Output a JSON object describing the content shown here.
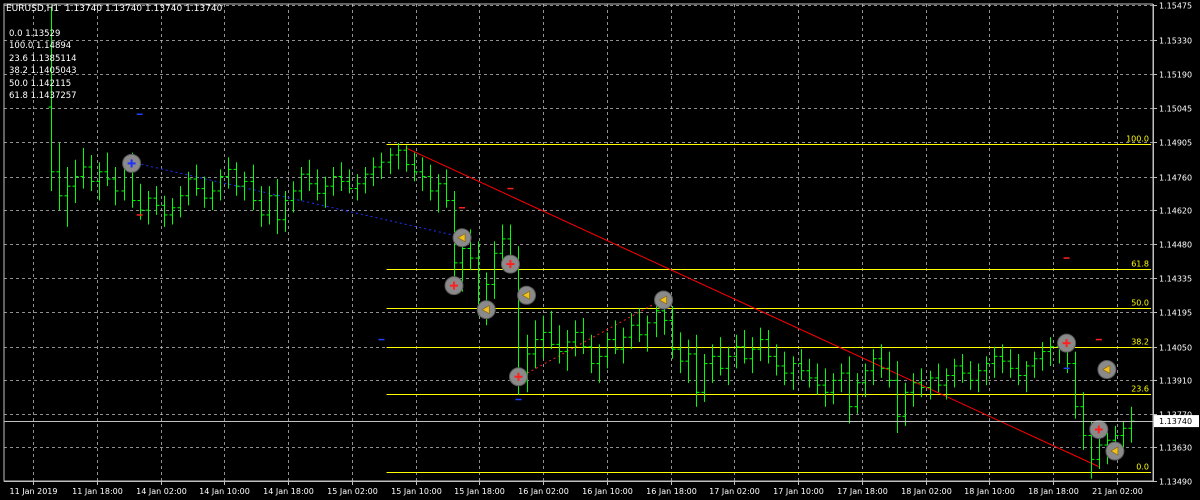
{
  "header": {
    "symbol": "EURUSD,H1",
    "ohlc": "1.13740 1.13740 1.13740 1.13740"
  },
  "fib_legend": [
    "0.0 1.13529",
    "100.0 1.14894",
    "23.6 1.1385114",
    "38.2 1.1405043",
    "50.0 1.142115",
    "61.8 1.1437257"
  ],
  "colors": {
    "background": "#000000",
    "grid": "#c0c0c0",
    "candle": "#00ff00",
    "fib_line": "#ffff00",
    "trend_line": "#ff0000",
    "current_price_bg": "#ffffff"
  },
  "chart_data": {
    "type": "candlestick",
    "symbol": "EURUSD",
    "timeframe": "H1",
    "ylim": [
      1.1349,
      1.1548
    ],
    "y_ticks": [
      "1.15475",
      "1.15330",
      "1.15190",
      "1.15045",
      "1.14905",
      "1.14760",
      "1.14620",
      "1.14480",
      "1.14335",
      "1.14195",
      "1.14050",
      "1.13910",
      "1.13770",
      "1.13630",
      "1.13490"
    ],
    "x_ticks": [
      "11 Jan 2019",
      "11 Jan 18:00",
      "14 Jan 02:00",
      "14 Jan 10:00",
      "14 Jan 18:00",
      "15 Jan 02:00",
      "15 Jan 10:00",
      "15 Jan 18:00",
      "16 Jan 02:00",
      "16 Jan 10:00",
      "16 Jan 18:00",
      "17 Jan 02:00",
      "17 Jan 10:00",
      "17 Jan 18:00",
      "18 Jan 02:00",
      "18 Jan 10:00",
      "18 Jan 18:00",
      "21 Jan 02:00"
    ],
    "current_price": "1.13740",
    "fib_levels": [
      {
        "label": "100.0",
        "price": 1.14894
      },
      {
        "label": "61.8",
        "price": 1.1437257
      },
      {
        "label": "50.0",
        "price": 1.142115
      },
      {
        "label": "38.2",
        "price": 1.1405043
      },
      {
        "label": "23.6",
        "price": 1.1385114
      },
      {
        "label": "0.0",
        "price": 1.13529
      }
    ],
    "fib_range_bars": [
      42,
      163
    ],
    "trendline": {
      "from": {
        "bar": 44,
        "price": 1.1488
      },
      "to": {
        "bar": 130,
        "price": 1.1355
      }
    },
    "dotted_trend": [
      {
        "from": {
          "bar": 10,
          "price": 1.1482
        },
        "to": {
          "bar": 52,
          "price": 1.145
        },
        "color": "#2030ff"
      },
      {
        "from": {
          "bar": 58,
          "price": 1.1392
        },
        "to": {
          "bar": 76,
          "price": 1.1425
        },
        "color": "#ff2020"
      }
    ],
    "signals": [
      {
        "bar": 10,
        "price": 1.14815,
        "kind": "buy-cross"
      },
      {
        "bar": 51,
        "price": 1.14505,
        "kind": "sell-arrow"
      },
      {
        "bar": 50,
        "price": 1.14305,
        "kind": "buy-cross"
      },
      {
        "bar": 57,
        "price": 1.14395,
        "kind": "buy-cross"
      },
      {
        "bar": 54,
        "price": 1.14205,
        "kind": "sell-arrow"
      },
      {
        "bar": 59,
        "price": 1.14265,
        "kind": "sell-arrow"
      },
      {
        "bar": 76,
        "price": 1.14245,
        "kind": "sell-arrow"
      },
      {
        "bar": 58,
        "price": 1.13925,
        "kind": "buy-cross"
      },
      {
        "bar": 126,
        "price": 1.14065,
        "kind": "buy-cross"
      },
      {
        "bar": 131,
        "price": 1.13955,
        "kind": "sell-arrow"
      },
      {
        "bar": 130,
        "price": 1.13705,
        "kind": "buy-cross"
      },
      {
        "bar": 132,
        "price": 1.13615,
        "kind": "sell-arrow"
      }
    ],
    "dashes": [
      {
        "bar": 11,
        "price": 1.1502,
        "color": "#2040ff"
      },
      {
        "bar": 11,
        "price": 1.146,
        "color": "#ff2020"
      },
      {
        "bar": 51,
        "price": 1.1463,
        "color": "#ff2020"
      },
      {
        "bar": 57,
        "price": 1.1471,
        "color": "#ff2020"
      },
      {
        "bar": 58,
        "price": 1.1383,
        "color": "#2040ff"
      },
      {
        "bar": 126,
        "price": 1.1442,
        "color": "#ff2020"
      },
      {
        "bar": 130,
        "price": 1.1408,
        "color": "#ff2020"
      },
      {
        "bar": 126,
        "price": 1.1396,
        "color": "#2040ff"
      },
      {
        "bar": 41,
        "price": 1.1408,
        "color": "#2040ff"
      }
    ],
    "bars": [
      [
        1.1505,
        1.1547,
        1.147,
        1.1478
      ],
      [
        1.1478,
        1.149,
        1.1462,
        1.1468
      ],
      [
        1.1468,
        1.148,
        1.1455,
        1.1472
      ],
      [
        1.1472,
        1.1483,
        1.1465,
        1.1476
      ],
      [
        1.1476,
        1.1488,
        1.1471,
        1.148
      ],
      [
        1.148,
        1.1485,
        1.147,
        1.1474
      ],
      [
        1.1474,
        1.1482,
        1.1466,
        1.1478
      ],
      [
        1.1478,
        1.1486,
        1.1472,
        1.1475
      ],
      [
        1.1475,
        1.148,
        1.1464,
        1.147
      ],
      [
        1.147,
        1.1484,
        1.1466,
        1.1481
      ],
      [
        1.1481,
        1.1486,
        1.1463,
        1.1466
      ],
      [
        1.1466,
        1.1473,
        1.1458,
        1.1462
      ],
      [
        1.1462,
        1.147,
        1.1456,
        1.1467
      ],
      [
        1.1467,
        1.1472,
        1.146,
        1.1464
      ],
      [
        1.1464,
        1.1468,
        1.1455,
        1.146
      ],
      [
        1.146,
        1.1467,
        1.1456,
        1.1463
      ],
      [
        1.1463,
        1.1472,
        1.1459,
        1.1468
      ],
      [
        1.1468,
        1.1478,
        1.1464,
        1.1475
      ],
      [
        1.1475,
        1.1481,
        1.1468,
        1.1471
      ],
      [
        1.1471,
        1.1476,
        1.1463,
        1.1467
      ],
      [
        1.1467,
        1.1474,
        1.1462,
        1.147
      ],
      [
        1.147,
        1.1479,
        1.1466,
        1.1476
      ],
      [
        1.1476,
        1.1484,
        1.1471,
        1.1479
      ],
      [
        1.1479,
        1.1482,
        1.1468,
        1.1472
      ],
      [
        1.1472,
        1.1478,
        1.1466,
        1.1474
      ],
      [
        1.1474,
        1.1481,
        1.1462,
        1.1466
      ],
      [
        1.1466,
        1.1472,
        1.1455,
        1.146
      ],
      [
        1.146,
        1.1472,
        1.1456,
        1.1468
      ],
      [
        1.1468,
        1.1475,
        1.1452,
        1.1458
      ],
      [
        1.1458,
        1.147,
        1.1453,
        1.1466
      ],
      [
        1.1466,
        1.1474,
        1.1461,
        1.147
      ],
      [
        1.147,
        1.148,
        1.1466,
        1.1477
      ],
      [
        1.1477,
        1.1483,
        1.147,
        1.1473
      ],
      [
        1.1473,
        1.1479,
        1.1466,
        1.1469
      ],
      [
        1.1469,
        1.1476,
        1.1463,
        1.1472
      ],
      [
        1.1472,
        1.148,
        1.1468,
        1.1476
      ],
      [
        1.1476,
        1.1482,
        1.147,
        1.1474
      ],
      [
        1.1474,
        1.1479,
        1.1469,
        1.1471
      ],
      [
        1.1471,
        1.1477,
        1.1466,
        1.1473
      ],
      [
        1.1473,
        1.148,
        1.1469,
        1.1477
      ],
      [
        1.1477,
        1.1484,
        1.1472,
        1.148
      ],
      [
        1.148,
        1.1486,
        1.1475,
        1.1482
      ],
      [
        1.1482,
        1.1488,
        1.1477,
        1.1485
      ],
      [
        1.1485,
        1.149,
        1.1479,
        1.1487
      ],
      [
        1.1487,
        1.1489,
        1.1478,
        1.1481
      ],
      [
        1.1481,
        1.1486,
        1.1474,
        1.1478
      ],
      [
        1.1478,
        1.1484,
        1.147,
        1.1476
      ],
      [
        1.1476,
        1.1481,
        1.1466,
        1.147
      ],
      [
        1.147,
        1.1477,
        1.1461,
        1.1473
      ],
      [
        1.1473,
        1.1479,
        1.1463,
        1.1466
      ],
      [
        1.1466,
        1.147,
        1.1432,
        1.144
      ],
      [
        1.144,
        1.1452,
        1.1428,
        1.1446
      ],
      [
        1.1446,
        1.1454,
        1.1437,
        1.1442
      ],
      [
        1.1442,
        1.1449,
        1.1418,
        1.1422
      ],
      [
        1.1422,
        1.1436,
        1.1414,
        1.1431
      ],
      [
        1.1431,
        1.1449,
        1.1425,
        1.1444
      ],
      [
        1.1444,
        1.1456,
        1.1439,
        1.145
      ],
      [
        1.145,
        1.1456,
        1.1436,
        1.144
      ],
      [
        1.144,
        1.1447,
        1.1385,
        1.1392
      ],
      [
        1.1392,
        1.141,
        1.1386,
        1.1402
      ],
      [
        1.1402,
        1.1416,
        1.1396,
        1.1408
      ],
      [
        1.1408,
        1.1418,
        1.14,
        1.1411
      ],
      [
        1.1411,
        1.142,
        1.1404,
        1.1406
      ],
      [
        1.1406,
        1.1414,
        1.1398,
        1.1403
      ],
      [
        1.1403,
        1.1412,
        1.1395,
        1.1407
      ],
      [
        1.1407,
        1.1416,
        1.1401,
        1.1411
      ],
      [
        1.1411,
        1.1417,
        1.1402,
        1.1405
      ],
      [
        1.1405,
        1.141,
        1.1394,
        1.1398
      ],
      [
        1.1398,
        1.1406,
        1.139,
        1.1401
      ],
      [
        1.1401,
        1.1411,
        1.1396,
        1.1408
      ],
      [
        1.1408,
        1.1416,
        1.1402,
        1.1404
      ],
      [
        1.1404,
        1.1413,
        1.1398,
        1.1409
      ],
      [
        1.1409,
        1.1419,
        1.1404,
        1.1414
      ],
      [
        1.1414,
        1.1421,
        1.1407,
        1.141
      ],
      [
        1.141,
        1.1418,
        1.1403,
        1.1415
      ],
      [
        1.1415,
        1.1424,
        1.1409,
        1.142
      ],
      [
        1.142,
        1.1428,
        1.141,
        1.1416
      ],
      [
        1.1416,
        1.1422,
        1.14,
        1.1404
      ],
      [
        1.1404,
        1.1411,
        1.1394,
        1.1399
      ],
      [
        1.1399,
        1.1408,
        1.139,
        1.1402
      ],
      [
        1.1402,
        1.141,
        1.138,
        1.1386
      ],
      [
        1.1386,
        1.1402,
        1.1382,
        1.1398
      ],
      [
        1.1398,
        1.1406,
        1.139,
        1.1401
      ],
      [
        1.1401,
        1.1409,
        1.1393,
        1.1396
      ],
      [
        1.1396,
        1.1405,
        1.1389,
        1.1401
      ],
      [
        1.1401,
        1.141,
        1.1396,
        1.1405
      ],
      [
        1.1405,
        1.1412,
        1.1398,
        1.14
      ],
      [
        1.14,
        1.1409,
        1.1394,
        1.1404
      ],
      [
        1.1404,
        1.1413,
        1.1399,
        1.1408
      ],
      [
        1.1408,
        1.1412,
        1.1398,
        1.1401
      ],
      [
        1.1401,
        1.1406,
        1.1393,
        1.1397
      ],
      [
        1.1397,
        1.1403,
        1.1389,
        1.1394
      ],
      [
        1.1394,
        1.1401,
        1.1387,
        1.1398
      ],
      [
        1.1398,
        1.1404,
        1.1391,
        1.1395
      ],
      [
        1.1395,
        1.14,
        1.1388,
        1.1392
      ],
      [
        1.1392,
        1.1398,
        1.1385,
        1.1389
      ],
      [
        1.1389,
        1.1396,
        1.138,
        1.1386
      ],
      [
        1.1386,
        1.1394,
        1.1381,
        1.1391
      ],
      [
        1.1391,
        1.1398,
        1.1386,
        1.1394
      ],
      [
        1.1394,
        1.1401,
        1.1373,
        1.138
      ],
      [
        1.138,
        1.1394,
        1.1377,
        1.139
      ],
      [
        1.139,
        1.1398,
        1.1384,
        1.1395
      ],
      [
        1.1395,
        1.1404,
        1.1389,
        1.14
      ],
      [
        1.14,
        1.1406,
        1.1392,
        1.1396
      ],
      [
        1.1396,
        1.1403,
        1.1388,
        1.1391
      ],
      [
        1.1391,
        1.1399,
        1.1369,
        1.1376
      ],
      [
        1.1376,
        1.139,
        1.1372,
        1.1386
      ],
      [
        1.1386,
        1.1394,
        1.138,
        1.139
      ],
      [
        1.139,
        1.1396,
        1.1384,
        1.1388
      ],
      [
        1.1388,
        1.1395,
        1.1383,
        1.1392
      ],
      [
        1.1392,
        1.1398,
        1.1386,
        1.1389
      ],
      [
        1.1389,
        1.1396,
        1.1383,
        1.1393
      ],
      [
        1.1393,
        1.14,
        1.1388,
        1.1397
      ],
      [
        1.1397,
        1.1402,
        1.139,
        1.1394
      ],
      [
        1.1394,
        1.1399,
        1.1387,
        1.1391
      ],
      [
        1.1391,
        1.1398,
        1.1386,
        1.1395
      ],
      [
        1.1395,
        1.1401,
        1.1389,
        1.1398
      ],
      [
        1.1398,
        1.1405,
        1.1392,
        1.1401
      ],
      [
        1.1401,
        1.1406,
        1.1394,
        1.1399
      ],
      [
        1.1399,
        1.1404,
        1.1392,
        1.1396
      ],
      [
        1.1396,
        1.1402,
        1.1389,
        1.1393
      ],
      [
        1.1393,
        1.1399,
        1.1386,
        1.1397
      ],
      [
        1.1397,
        1.1403,
        1.1392,
        1.14
      ],
      [
        1.14,
        1.1407,
        1.1395,
        1.1403
      ],
      [
        1.1403,
        1.1409,
        1.1397,
        1.1405
      ],
      [
        1.1405,
        1.1409,
        1.1398,
        1.1406
      ],
      [
        1.1406,
        1.1408,
        1.1394,
        1.1398
      ],
      [
        1.1398,
        1.1403,
        1.1375,
        1.138
      ],
      [
        1.138,
        1.1386,
        1.1362,
        1.1368
      ],
      [
        1.1368,
        1.1374,
        1.135,
        1.1358
      ],
      [
        1.1358,
        1.1368,
        1.1354,
        1.1364
      ],
      [
        1.1364,
        1.137,
        1.1356,
        1.1366
      ],
      [
        1.1366,
        1.1372,
        1.1359,
        1.1368
      ],
      [
        1.1368,
        1.1374,
        1.1362,
        1.1371
      ],
      [
        1.1371,
        1.138,
        1.1365,
        1.1374
      ]
    ]
  }
}
